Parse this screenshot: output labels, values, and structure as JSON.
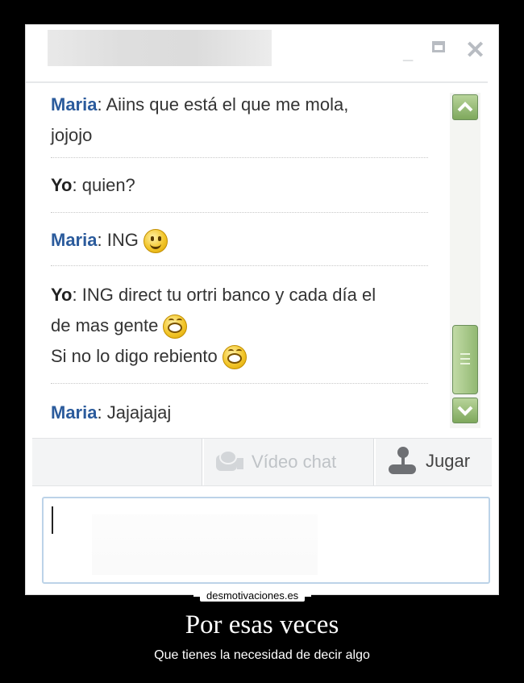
{
  "window": {
    "minimize": "_",
    "close": "✕"
  },
  "chat": {
    "messages": [
      {
        "sender": "Maria",
        "lines": [
          "Aiins que está el que me mola,",
          "jojojo"
        ]
      },
      {
        "sender": "Yo",
        "lines": [
          "quien?"
        ]
      },
      {
        "sender": "Maria",
        "lines": [
          "ING"
        ],
        "emoji": "smile-icon"
      },
      {
        "sender": "Yo",
        "lines": [
          "ING direct tu ortri banco y cada día el",
          "de mas gente",
          "Si no lo digo rebiento"
        ],
        "emoji": "laugh-icon"
      },
      {
        "sender": "Maria",
        "lines": [
          "Jajajajaj"
        ]
      }
    ]
  },
  "toolbar": {
    "video_chat_label": "Vídeo chat",
    "play_label": "Jugar"
  },
  "colors": {
    "sender_maria": "#2b5b9c",
    "scroll_green": "#7ea85c",
    "input_border": "#bcd3e8"
  },
  "poster": {
    "brand": "desmotivaciones.es",
    "title": "Por esas veces",
    "subtitle": "Que tienes la necesidad de decir algo"
  }
}
